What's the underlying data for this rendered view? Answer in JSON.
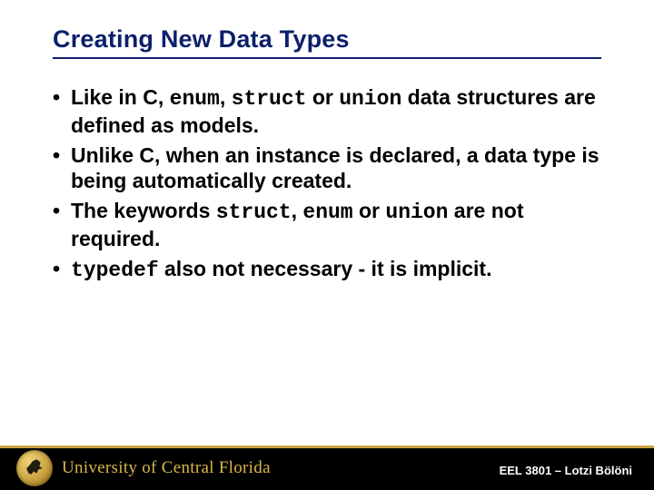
{
  "title": "Creating New Data Types",
  "bullets": {
    "b1": {
      "t1": "Like in C, ",
      "c1": "enum",
      "t2": ", ",
      "c2": "struct",
      "t3": " or ",
      "c3": "union",
      "t4": " data structures are defined as models."
    },
    "b2": "Unlike C, when an instance is declared, a data type is being automatically created.",
    "b3": {
      "t1": "The keywords ",
      "c1": "struct",
      "t2": ", ",
      "c2": "enum",
      "t3": " or ",
      "c3": "union",
      "t4": " are  not required."
    },
    "b4": {
      "c1": "typedef",
      "t1": " also not necessary - it is implicit."
    }
  },
  "footer": {
    "university": "University of Central Florida",
    "course": "EEL 3801 – Lotzi Bölöni"
  }
}
